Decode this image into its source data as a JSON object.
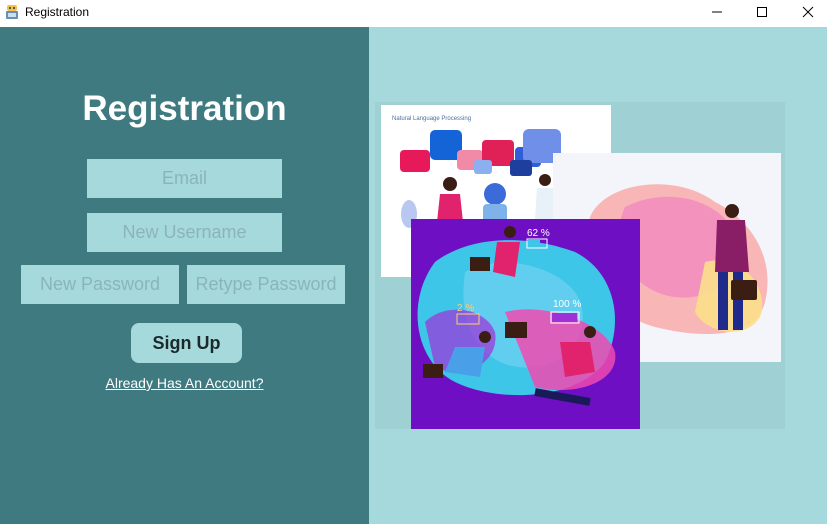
{
  "window": {
    "title": "Registration",
    "icon": "app-icon",
    "controls": [
      "minimize-icon",
      "maximize-icon",
      "close-icon"
    ]
  },
  "form": {
    "heading": "Registration",
    "email_placeholder": "Email",
    "username_placeholder": "New Username",
    "password_placeholder": "New Password",
    "retype_placeholder": "Retype Password",
    "signup_label": "Sign Up",
    "login_link": "Already Has An Account?"
  },
  "illustration": {
    "card_caption": "Natural Language Processing",
    "battery_labels": [
      "62 %",
      "2 %",
      "100 %"
    ]
  },
  "colors": {
    "left_panel": "#3e7a80",
    "right_panel": "#a6d9dc",
    "field_bg": "#a6d9dc",
    "purple_card": "#6f0fc4"
  }
}
